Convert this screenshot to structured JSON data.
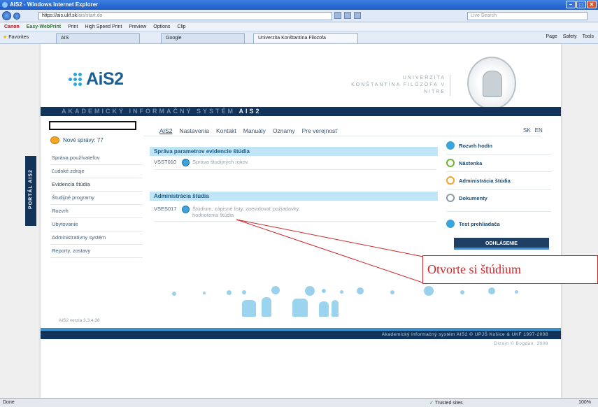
{
  "window": {
    "title": "AIS2 - Windows Internet Explorer"
  },
  "browser": {
    "url_host": "https://ais.ukf.sk",
    "url_path": "/ais/start.do",
    "search_placeholder": "Live Search",
    "canon_brand": "Canon",
    "canon_tool": "Easy-WebPrint",
    "canon_items": [
      "Print",
      "High Speed Print",
      "Preview",
      "Options",
      "Clip"
    ],
    "favorites": "Favorites",
    "tabs": [
      "AIS",
      "Google",
      "Univerzita Konštantína Filozofa"
    ],
    "commands": [
      "Page",
      "Safety",
      "Tools"
    ],
    "status_left": "Done",
    "status_trusted": "Trusted sites",
    "status_zoom": "100%"
  },
  "page": {
    "logo": "AiS2",
    "university": "UNIVERZITA KONŠTANTÍNA FILOZOFA V NITRE",
    "system_bar_dim": "AKADEMICKÝ INFORMAČNÝ SYSTÉM",
    "system_bar_bold": "AIS2",
    "portal_tab": "PORTÁL AIS2",
    "messages": "Nové správy: 77",
    "sidebar": [
      "Správa používateľov",
      "Ľudské zdroje",
      "Evidencia štúdia",
      "Študijné programy",
      "Rozvrh",
      "Ubytovanie",
      "Administratívny systém",
      "Reporty, zostavy"
    ],
    "version": "AIS2 verzia 3.3.4.38",
    "topnav": [
      "AIS2",
      "Nastavenia",
      "Kontakt",
      "Manuály",
      "Oznamy",
      "Pre verejnosť"
    ],
    "langs": [
      "SK",
      "EN"
    ],
    "sections": [
      {
        "title": "Správa parametrov evidencie štúdia",
        "rows": [
          {
            "code": "VSST010",
            "desc": "Správa študijných rokov"
          }
        ]
      },
      {
        "title": "Administrácia štúdia",
        "rows": [
          {
            "code": "VSES017",
            "desc": "Štúdium, zápisné listy, zaevidovať požiadavky, hodnotenia štúdia"
          }
        ]
      }
    ],
    "right_menu": [
      "Rozvrh hodín",
      "Nástenka",
      "Administrácia štúdia",
      "Dokumenty",
      "Test prehliadača"
    ],
    "logout": "ODHLÁSENIE",
    "footer": "Akademický informačný systém AIS2 © UPJŠ Košice & UKF 1997-2008",
    "copyright": "Dizajn © Bogdan, 2008"
  },
  "annotation": {
    "text": "Otvorte si štúdium",
    "color": "#d0262a"
  }
}
